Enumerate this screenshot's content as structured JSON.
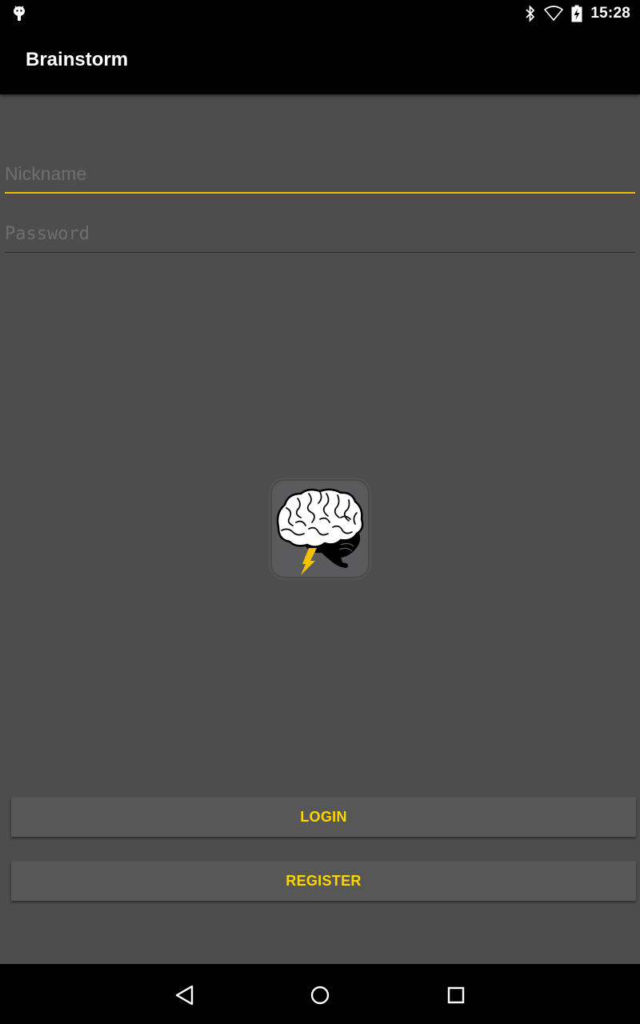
{
  "status_bar": {
    "time": "15:28",
    "icons": [
      "android-debug-icon",
      "bluetooth-icon",
      "wifi-icon",
      "battery-charging-icon"
    ]
  },
  "app_bar": {
    "title": "Brainstorm"
  },
  "form": {
    "nickname": {
      "placeholder": "Nickname",
      "value": ""
    },
    "password": {
      "placeholder": "Password",
      "value": ""
    }
  },
  "logo": {
    "icon": "brain-lightning-logo"
  },
  "buttons": {
    "login": "LOGIN",
    "register": "REGISTER"
  },
  "nav_bar": {
    "icons": [
      "back-icon",
      "home-icon",
      "recents-icon"
    ]
  },
  "colors": {
    "accent": "#ffd500",
    "background": "#4d4d4d",
    "bar": "#000000"
  }
}
